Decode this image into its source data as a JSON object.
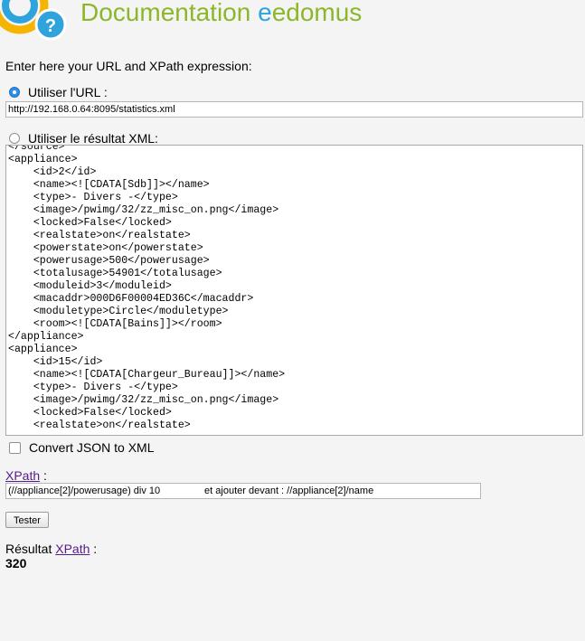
{
  "header": {
    "title_prefix": "Documentation ",
    "title_e": "e",
    "title_suffix": "edomus"
  },
  "intro": "Enter here your URL and XPath expression:",
  "source_options": {
    "url_label": "Utiliser l'URL :",
    "url_selected": true,
    "xml_label": "Utiliser le résultat XML:",
    "xml_selected": false
  },
  "url_field": {
    "value": "http://192.168.0.64:8095/statistics.xml"
  },
  "xml_result": {
    "lines": [
      "</source>",
      "<appliance>",
      "    <id>2</id>",
      "    <name><![CDATA[Sdb]]></name>",
      "    <type>- Divers -</type>",
      "    <image>/pwimg/32/zz_misc_on.png</image>",
      "    <locked>False</locked>",
      "    <realstate>on</realstate>",
      "    <powerstate>on</powerstate>",
      "    <powerusage>500</powerusage>",
      "    <totalusage>54901</totalusage>",
      "    <moduleid>3</moduleid>",
      "    <macaddr>000D6F00004ED36C</macaddr>",
      "    <moduletype>Circle</moduletype>",
      "    <room><![CDATA[Bains]]></room>",
      "</appliance>",
      "<appliance>",
      "    <id>15</id>",
      "    <name><![CDATA[Chargeur_Bureau]]></name>",
      "    <type>- Divers -</type>",
      "    <image>/pwimg/32/zz_misc_on.png</image>",
      "    <locked>False</locked>",
      "    <realstate>on</realstate>"
    ]
  },
  "convert_json": {
    "label": "Convert JSON to XML",
    "checked": false
  },
  "xpath": {
    "link_text": "XPath",
    "label_suffix": " :",
    "value": "(//appliance[2]/powerusage) div 10                et ajouter devant : //appliance[2]/name"
  },
  "test_button": {
    "label": "Tester"
  },
  "result": {
    "prefix": "Résultat ",
    "link_text": "XPath",
    "suffix": " :",
    "value": "320"
  },
  "colors": {
    "title_green": "#8cb72a",
    "title_blue": "#2fa4dc",
    "logo_yellow": "#f5b400",
    "logo_blue": "#2fa4dc",
    "link": "#551a8b",
    "radio_selected": "#2f8ee8"
  },
  "icons": {
    "logo": "eedomus-logo-question-icon"
  }
}
